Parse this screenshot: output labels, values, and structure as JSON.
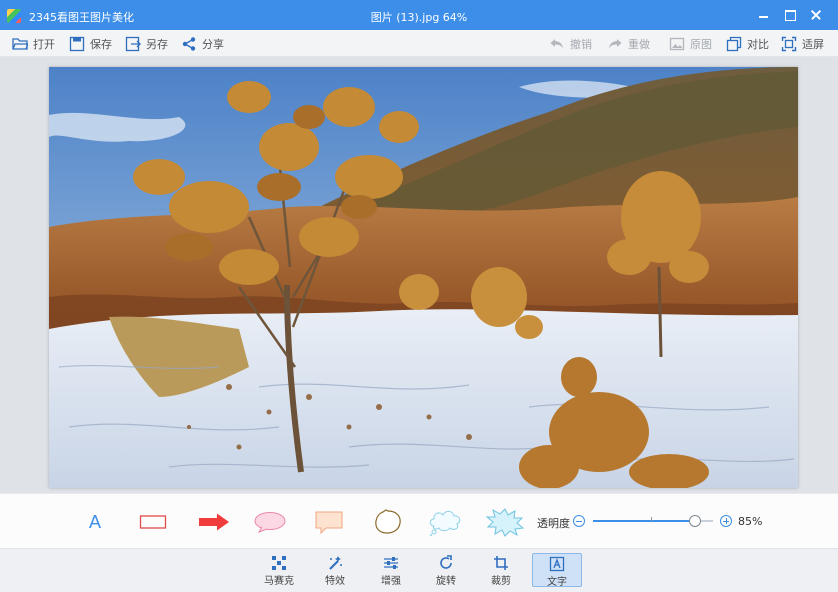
{
  "window": {
    "app_title": "2345看图王图片美化",
    "document_title": "图片 (13).jpg  64%"
  },
  "toolbar": {
    "open": "打开",
    "save": "保存",
    "save_as": "另存",
    "share": "分享",
    "undo": "撤销",
    "redo": "重做",
    "original": "原图",
    "compare": "对比",
    "fit_screen": "适屏"
  },
  "annotation": {
    "tools": [
      {
        "name": "text-tool-button",
        "label": "A"
      },
      {
        "name": "rectangle-tool-button"
      },
      {
        "name": "arrow-tool-button"
      },
      {
        "name": "ellipse-callout-button"
      },
      {
        "name": "rect-callout-button"
      },
      {
        "name": "thought-bubble-button"
      },
      {
        "name": "cloud-callout-button"
      },
      {
        "name": "burst-callout-button"
      }
    ],
    "opacity_label": "透明度",
    "opacity_value": "85%",
    "opacity_percent": 85
  },
  "bottom_bar": {
    "mosaic": "马赛克",
    "effects": "特效",
    "enhance": "增强",
    "rotate": "旋转",
    "crop": "裁剪",
    "text": "文字"
  },
  "colors": {
    "title_bar": "#3d8ee9",
    "accent": "#3d8ee9",
    "arrow_red": "#f03c3c"
  }
}
